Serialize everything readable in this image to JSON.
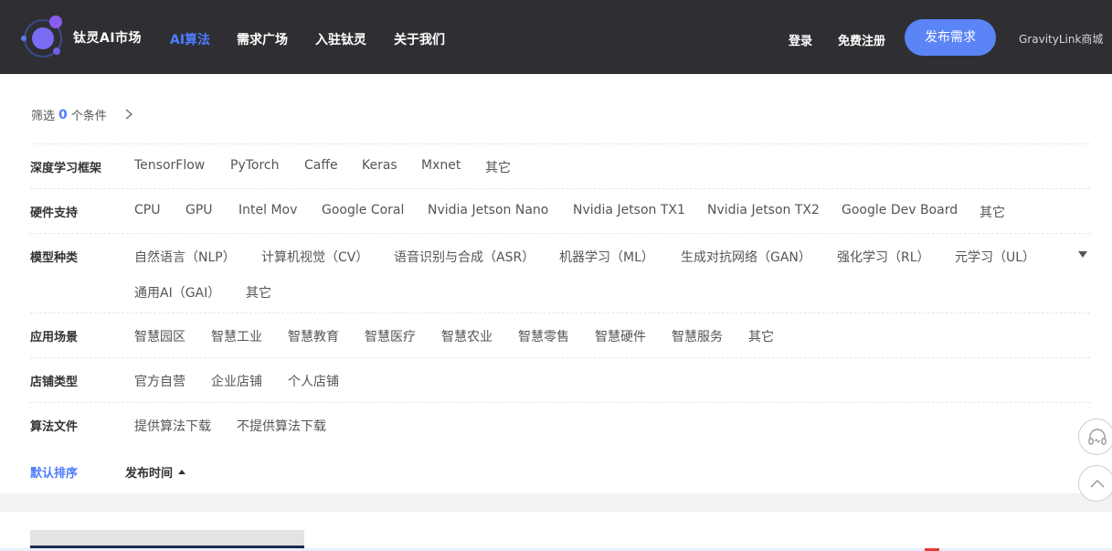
{
  "header": {
    "brand": "钛灵AI市场",
    "nav": [
      {
        "label": "AI算法",
        "active": true
      },
      {
        "label": "需求广场",
        "active": false
      },
      {
        "label": "入驻钛灵",
        "active": false
      },
      {
        "label": "关于我们",
        "active": false
      }
    ],
    "login": "登录",
    "register": "免费注册",
    "publish": "发布需求",
    "shop": "GravityLink商城"
  },
  "filter": {
    "prefix": "筛选",
    "count": "0",
    "suffix": "个条件"
  },
  "rows": [
    {
      "label": "深度学习框架",
      "options": [
        "TensorFlow",
        "PyTorch",
        "Caffe",
        "Keras",
        "Mxnet",
        "其它"
      ]
    },
    {
      "label": "硬件支持",
      "options": [
        "CPU",
        "GPU",
        "Intel Mov",
        "Google Coral",
        "Nvidia Jetson Nano",
        "Nvidia Jetson TX1",
        "Nvidia Jetson TX2",
        "Google Dev Board",
        "其它"
      ]
    },
    {
      "label": "模型种类",
      "options": [
        "自然语言（NLP）",
        "计算机视觉（CV）",
        "语音识别与合成（ASR）",
        "机器学习（ML）",
        "生成对抗网络（GAN）",
        "强化学习（RL）",
        "元学习（UL）",
        "通用AI（GAI）",
        "其它"
      ]
    },
    {
      "label": "应用场景",
      "options": [
        "智慧园区",
        "智慧工业",
        "智慧教育",
        "智慧医疗",
        "智慧农业",
        "智慧零售",
        "智慧硬件",
        "智慧服务",
        "其它"
      ]
    },
    {
      "label": "店铺类型",
      "options": [
        "官方自营",
        "企业店铺",
        "个人店铺"
      ]
    },
    {
      "label": "算法文件",
      "options": [
        "提供算法下载",
        "不提供算法下载"
      ]
    }
  ],
  "sort": {
    "default": "默认排序",
    "time": "发布时间"
  },
  "colors": {
    "header_bg": "#2f2f33",
    "accent": "#4f7cff",
    "button": "#5b84f7"
  },
  "icons": {
    "support": "headset-icon",
    "top": "chevron-up-icon"
  }
}
